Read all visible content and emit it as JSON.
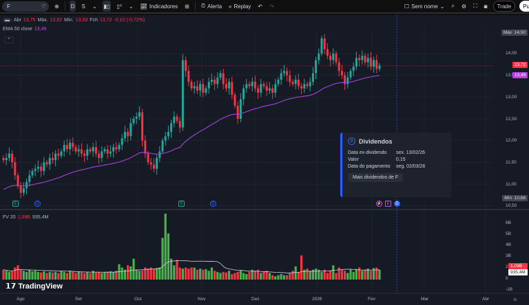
{
  "toolbar": {
    "symbol": "F",
    "intervals": [
      "D",
      "S"
    ],
    "indicators": "Indicadores",
    "alert": "Alerta",
    "replay": "Replay",
    "layout_name": "Sem nome",
    "trade": "Trade",
    "publish": "Pu"
  },
  "legend": {
    "open_label": "Abr",
    "open": "13,75",
    "high_label": "Máx.",
    "high": "13,82",
    "low_label": "Mín.",
    "low": "13,53",
    "close_label": "Fch",
    "close": "13,72",
    "change": "-0,10 (-0,72%)",
    "ema_label": "EMA 50 close",
    "ema": "13,49",
    "vol_label": "FV 20",
    "vol": "1,09B",
    "vol_ma": "935,4M"
  },
  "price_axis": {
    "ticks": [
      "14,00",
      "13,50",
      "13,00",
      "12,50",
      "12,00",
      "11,50",
      "11,00",
      "10,50"
    ],
    "max_label": "Máx",
    "max": "14,50",
    "min_label": "Mín",
    "min": "10,68",
    "last": "13,72",
    "ema": "13,49"
  },
  "volume_axis": {
    "ticks": [
      "6B",
      "5B",
      "4B",
      "3B",
      "2B",
      "0",
      "-1B"
    ],
    "last": "1,09B",
    "ma": "935,4M"
  },
  "time_axis": [
    "Ago",
    "Set",
    "Out",
    "Nov",
    "Dez",
    "2026",
    "Fev",
    "Mar",
    "Abr"
  ],
  "events": [
    {
      "type": "E"
    },
    {
      "type": "D"
    },
    {
      "type": "E"
    },
    {
      "type": "D"
    },
    {
      "type": "⚡"
    },
    {
      "type": "E"
    },
    {
      "type": "D"
    }
  ],
  "popup": {
    "title": "Dividendos",
    "rows": [
      {
        "label": "Data ex-dividendo",
        "value": "sex. 13/02/26"
      },
      {
        "label": "Valor",
        "value": "0,15"
      },
      {
        "label": "Data do pagamento",
        "value": "seg. 02/03/26"
      }
    ],
    "button": "Mais dividendos de F"
  },
  "logo": "TradingView",
  "colors": {
    "up": "#26a69a",
    "down": "#f23645",
    "vol_up": "#4caf50",
    "vol_down": "#f23645",
    "ema": "#9c3fd0",
    "bg": "#161a25",
    "accent": "#2962ff"
  },
  "chart_data": {
    "type": "candlestick",
    "ylim": [
      10.5,
      14.5
    ],
    "closes": [
      11.55,
      11.6,
      11.7,
      11.5,
      11.2,
      10.95,
      10.8,
      10.9,
      11.05,
      11.2,
      11.3,
      11.35,
      11.4,
      11.3,
      11.5,
      11.45,
      11.6,
      11.55,
      11.7,
      11.65,
      11.75,
      11.9,
      11.8,
      11.95,
      11.85,
      11.75,
      11.8,
      11.7,
      11.65,
      11.8,
      11.75,
      11.85,
      11.7,
      11.6,
      11.75,
      11.8,
      11.7,
      11.75,
      11.85,
      11.8,
      11.9,
      12.05,
      12.2,
      12.1,
      12.4,
      12.5,
      12.55,
      12.65,
      12.0,
      11.7,
      11.5,
      11.45,
      11.35,
      11.6,
      11.75,
      12.0,
      12.1,
      12.2,
      12.4,
      12.55,
      12.45,
      12.3,
      13.85,
      13.6,
      13.35,
      13.2,
      13.25,
      13.15,
      13.3,
      13.1,
      13.2,
      13.35,
      13.4,
      13.3,
      13.45,
      13.55,
      13.3,
      13.2,
      13.35,
      13.05,
      12.8,
      12.5,
      12.95,
      13.2,
      13.3,
      13.25,
      13.35,
      13.2,
      13.1,
      13.3,
      13.25,
      13.15,
      13.2,
      13.1,
      13.3,
      13.4,
      13.55,
      13.6,
      13.5,
      13.35,
      13.3,
      13.4,
      13.25,
      13.2,
      13.3,
      13.25,
      13.35,
      13.55,
      13.85,
      14.0,
      14.35,
      14.1,
      13.95,
      13.85,
      14.0,
      13.8,
      13.6,
      13.5,
      13.3,
      13.45,
      13.6,
      13.7,
      13.9,
      13.85,
      13.95,
      13.8,
      13.9,
      13.7,
      13.85,
      13.65,
      13.72
    ],
    "volumes_B": [
      0.9,
      0.8,
      0.7,
      0.75,
      1.1,
      1.3,
      0.9,
      0.8,
      0.7,
      0.85,
      0.75,
      0.8,
      0.7,
      0.65,
      0.75,
      0.6,
      0.7,
      0.65,
      0.7,
      0.6,
      0.75,
      0.7,
      0.6,
      0.8,
      0.7,
      0.6,
      0.75,
      0.65,
      0.6,
      0.7,
      0.6,
      0.8,
      0.65,
      0.7,
      0.6,
      0.65,
      0.7,
      0.75,
      0.7,
      0.8,
      1.4,
      1.1,
      0.9,
      1.3,
      1.2,
      1.9,
      0.9,
      0.8,
      0.85,
      1.1,
      1.0,
      1.1,
      0.95,
      1.05,
      1.1,
      3.8,
      6.0,
      4.2,
      1.9,
      1.3,
      1.8,
      1.1,
      1.0,
      1.1,
      1.0,
      1.1,
      1.1,
      0.9,
      1.0,
      0.9,
      0.95,
      0.8,
      1.1,
      0.8,
      0.7,
      0.6,
      0.7,
      0.65,
      0.8,
      0.5,
      0.6,
      0.7,
      0.8,
      0.6,
      0.5,
      0.7,
      0.9,
      0.8,
      0.9,
      0.6,
      0.7,
      0.8,
      0.6,
      0.4,
      0.3,
      0.4,
      0.5,
      0.4,
      0.4,
      0.6,
      0.8,
      1.2,
      0.7,
      2.2,
      0.9,
      1.0,
      0.8,
      0.9,
      1.0,
      0.9,
      0.7,
      0.9,
      0.6,
      0.8,
      1.3,
      0.6,
      1.1,
      0.9,
      0.8,
      0.6,
      0.9,
      0.7,
      0.9,
      1.1,
      0.8,
      0.9,
      1.0,
      0.8,
      1.05,
      1.09,
      0.9
    ]
  }
}
